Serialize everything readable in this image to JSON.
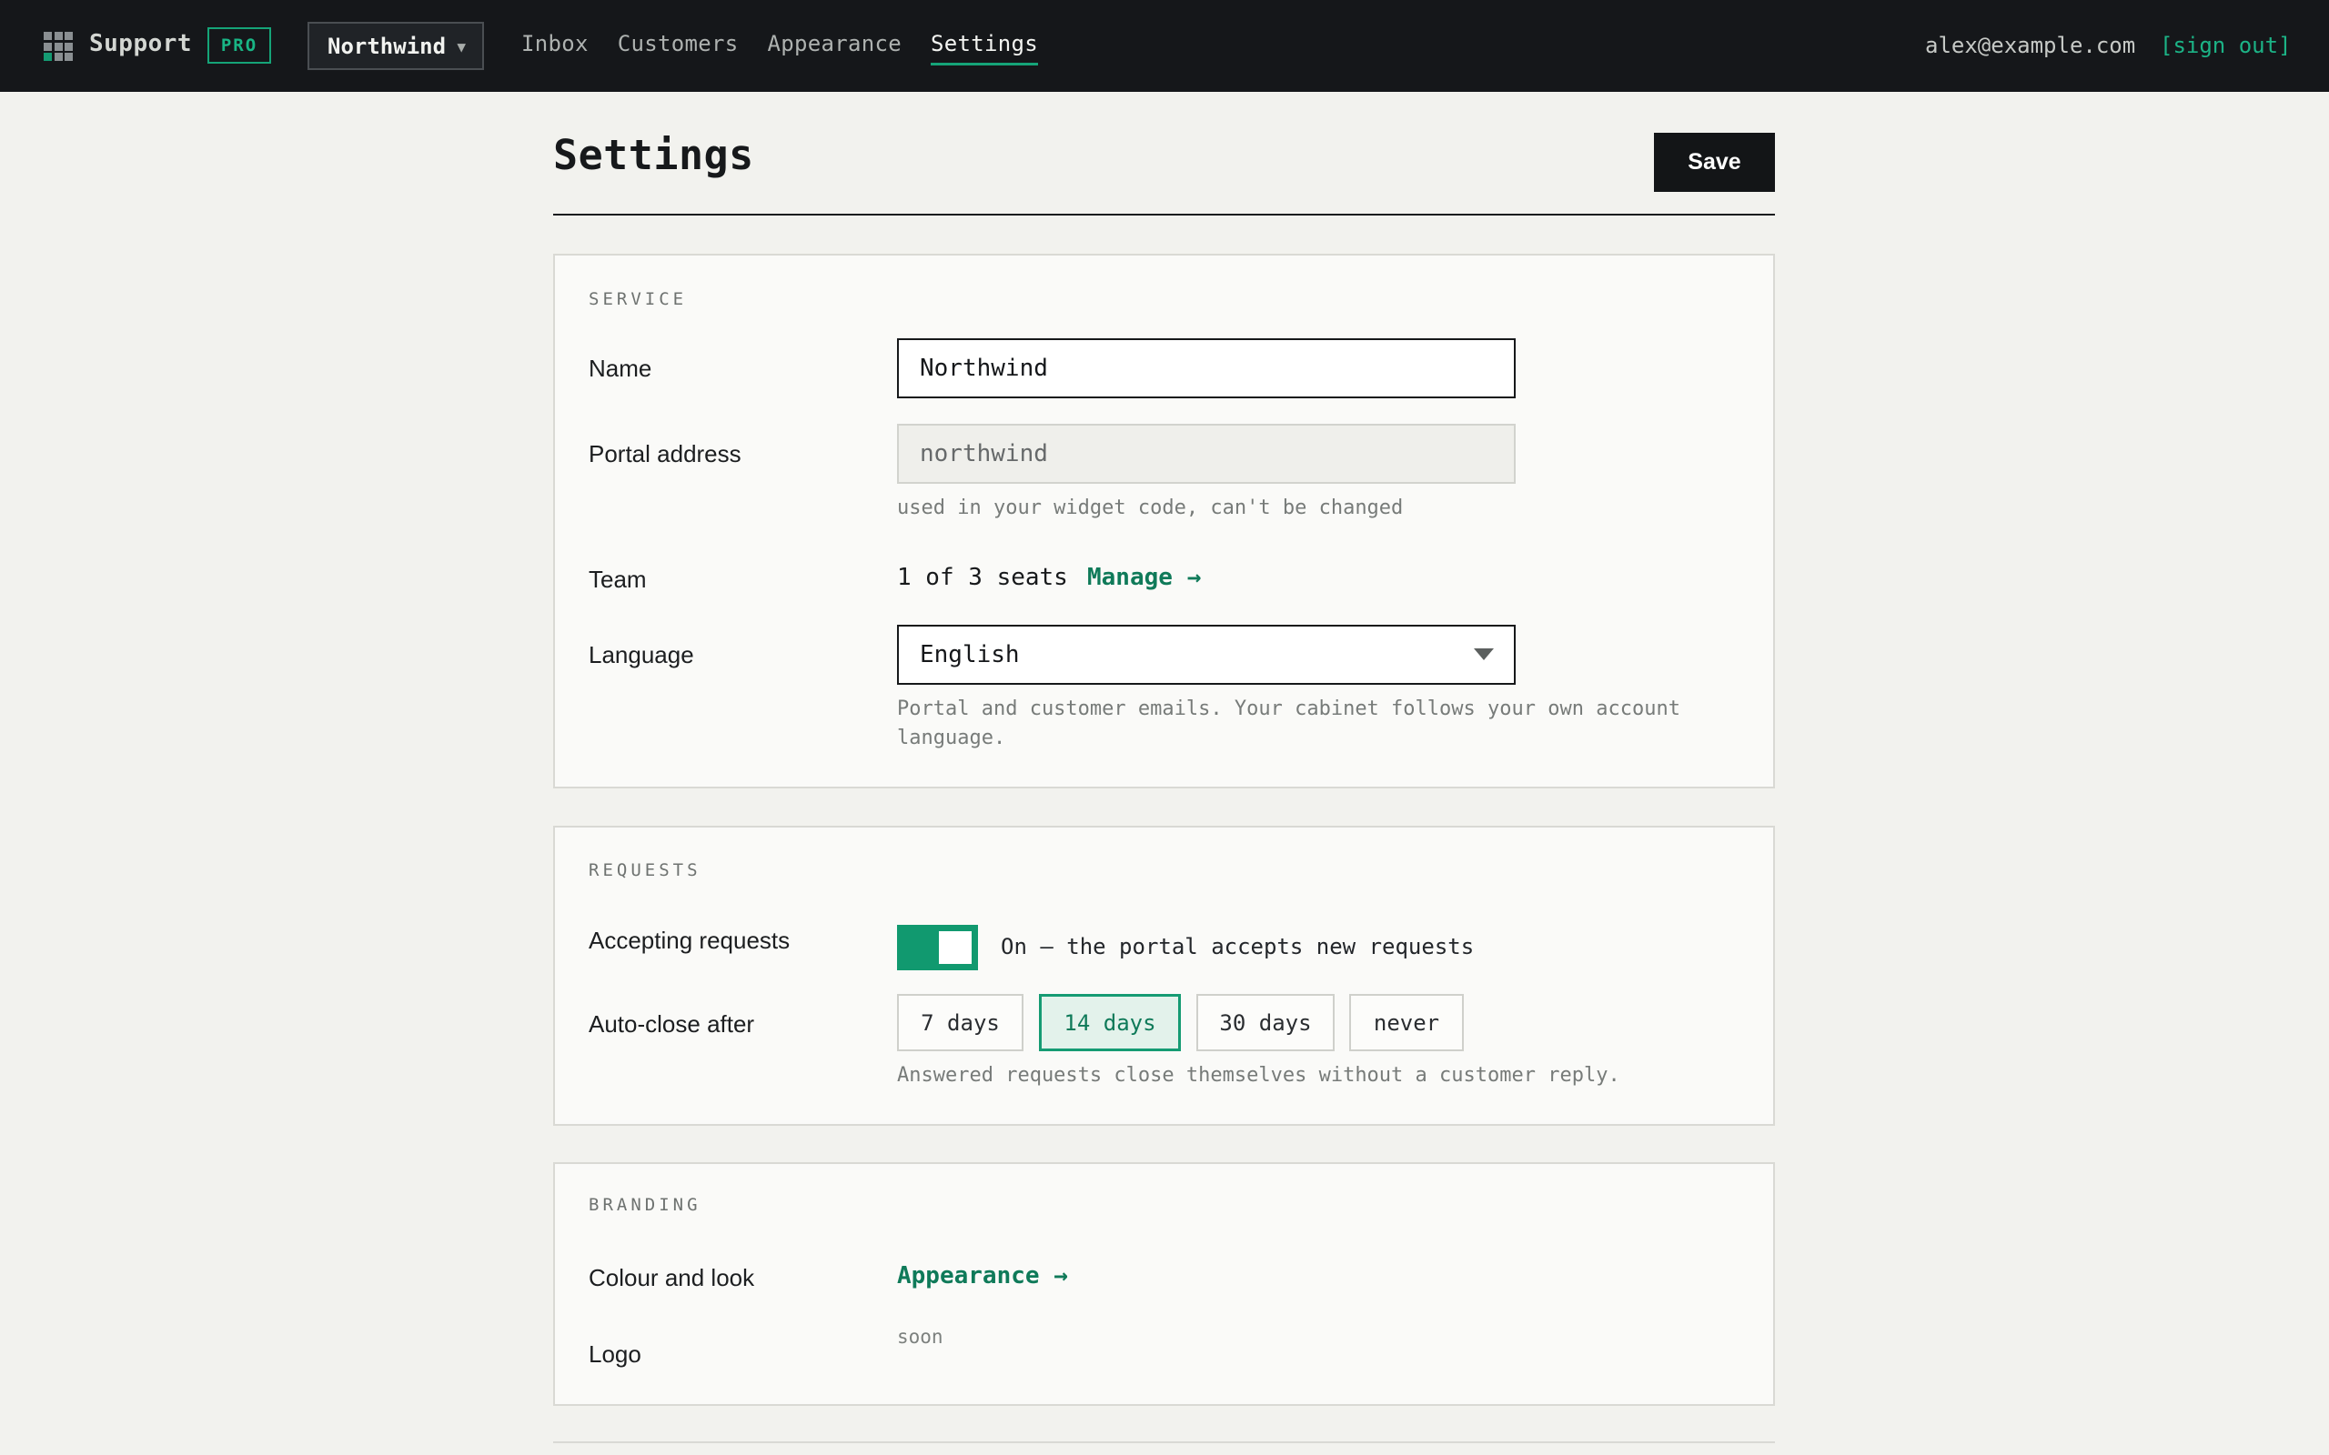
{
  "app": {
    "brand": "Support",
    "plan_badge": "PRO",
    "service_switcher": "Northwind",
    "nav": [
      "Inbox",
      "Customers",
      "Appearance",
      "Settings"
    ],
    "active_nav": "Settings",
    "account_email": "alex@example.com",
    "sign_out": "[sign out]",
    "accent_color": "#15a478"
  },
  "page": {
    "title": "Settings",
    "save_label": "Save"
  },
  "service": {
    "section_title": "SERVICE",
    "name_label": "Name",
    "name_value": "Northwind",
    "portal_label": "Portal address",
    "portal_value": "northwind",
    "portal_hint": "used in your widget code, can't be changed",
    "team_label": "Team",
    "team_value": "1 of 3 seats",
    "team_link": "Manage →",
    "language_label": "Language",
    "language_value": "English",
    "language_hint": "Portal and customer emails. Your cabinet follows your own account language."
  },
  "requests": {
    "section_title": "REQUESTS",
    "accepting_label": "Accepting requests",
    "accepting_on": true,
    "accepting_text": "On — the portal accepts new requests",
    "autoclose_label": "Auto-close after",
    "autoclose_options": [
      "7 days",
      "14 days",
      "30 days",
      "never"
    ],
    "autoclose_selected": "14 days",
    "autoclose_hint": "Answered requests close themselves without a customer reply."
  },
  "branding": {
    "section_title": "BRANDING",
    "colour_label": "Colour and look",
    "colour_link": "Appearance →",
    "logo_label": "Logo",
    "logo_value": "soon"
  }
}
